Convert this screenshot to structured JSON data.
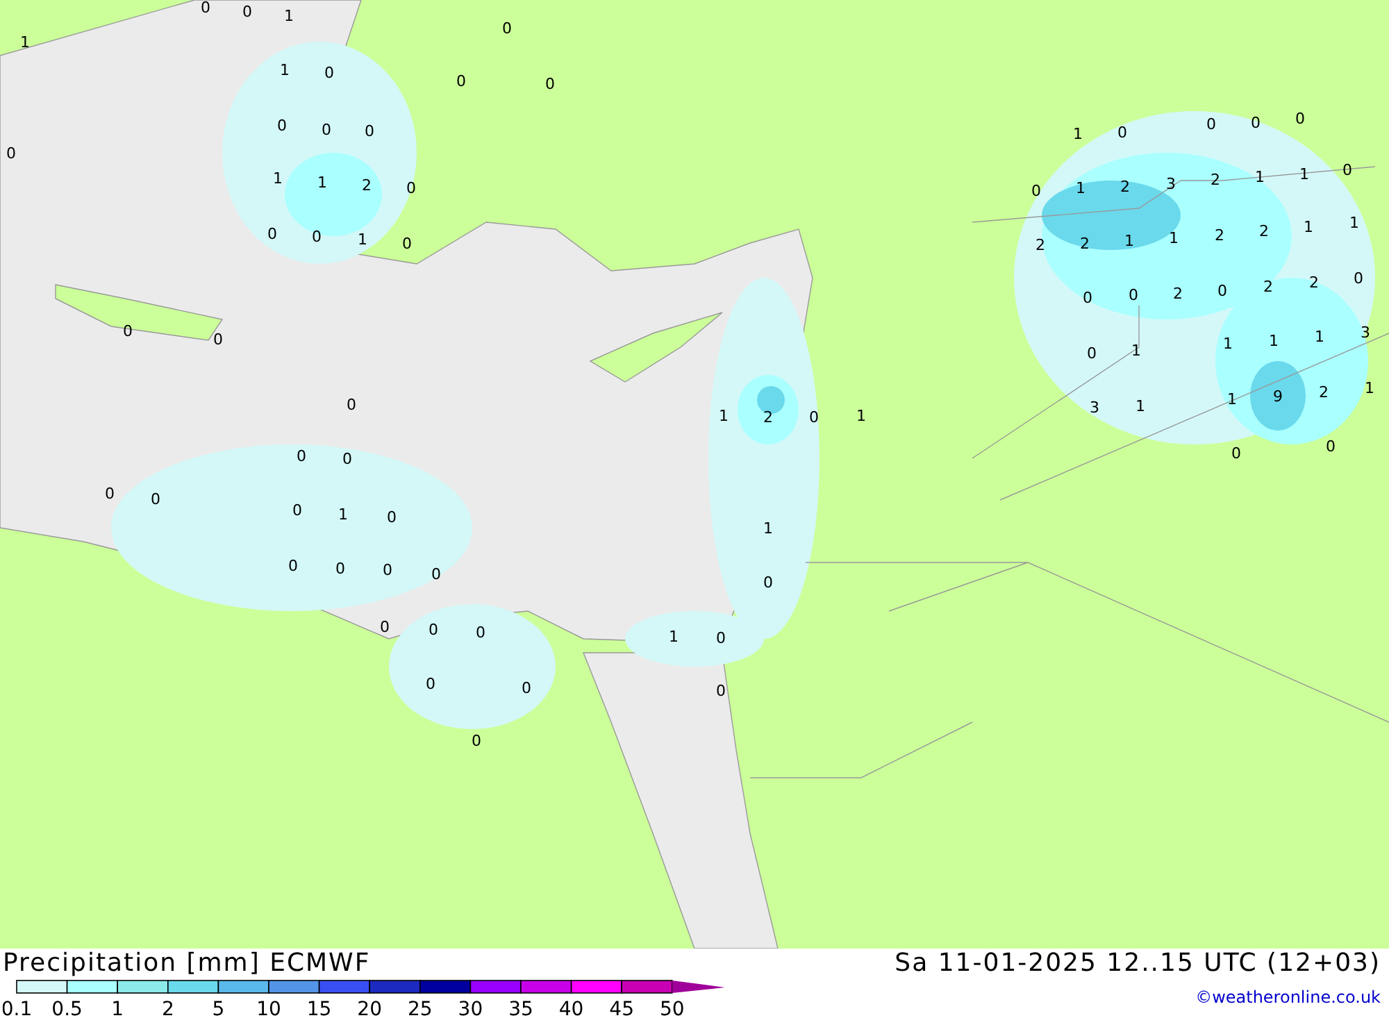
{
  "map": {
    "labels": [
      "0",
      "0",
      "1",
      "1",
      "0",
      "1",
      "0",
      "0",
      "0",
      "0",
      "0",
      "0",
      "1",
      "0",
      "0",
      "0",
      "0",
      "0",
      "1",
      "1",
      "2",
      "0",
      "0",
      "1",
      "2",
      "3",
      "2",
      "1",
      "1",
      "0",
      "0",
      "0",
      "1",
      "0",
      "2",
      "2",
      "1",
      "1",
      "2",
      "2",
      "1",
      "1",
      "0",
      "0",
      "2",
      "0",
      "2",
      "2",
      "0",
      "0",
      "0",
      "0",
      "1",
      "1",
      "1",
      "1",
      "3",
      "0",
      "1",
      "2",
      "0",
      "1",
      "3",
      "1",
      "1",
      "9",
      "2",
      "1",
      "0",
      "0",
      "0",
      "0",
      "0",
      "0",
      "0",
      "1",
      "0",
      "1",
      "0",
      "0",
      "0",
      "0",
      "0",
      "0",
      "0",
      "0",
      "1",
      "0",
      "0",
      "0",
      "0",
      "0"
    ]
  },
  "title": "Precipitation [mm] ECMWF",
  "valid_time": "Sa 11-01-2025 12..15 UTC (12+03)",
  "legend": {
    "bins": [
      {
        "color": "#d4f8f8"
      },
      {
        "color": "#aaffff"
      },
      {
        "color": "#8ceaea"
      },
      {
        "color": "#6ad9ec"
      },
      {
        "color": "#5ab8ea"
      },
      {
        "color": "#5494e8"
      },
      {
        "color": "#3a4ff2"
      },
      {
        "color": "#1c2ac0"
      },
      {
        "color": "#00009e"
      },
      {
        "color": "#9900ff"
      },
      {
        "color": "#c800ea"
      },
      {
        "color": "#ff00ff"
      },
      {
        "color": "#c800b4"
      }
    ],
    "overflow": {
      "color": "#a0009a"
    },
    "ticks": [
      "0.1",
      "0.5",
      "1",
      "2",
      "5",
      "10",
      "15",
      "20",
      "25",
      "30",
      "35",
      "40",
      "45",
      "50"
    ]
  },
  "credit": "©weatheronline.co.uk"
}
